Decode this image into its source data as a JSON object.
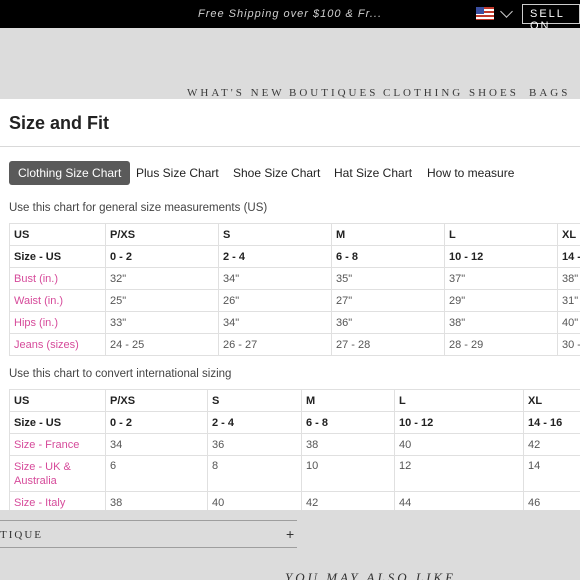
{
  "topbar": {
    "promo": "Free Shipping over $100 & Fr...",
    "flag_icon": "us-flag-icon",
    "chevron_icon": "chevron-down-icon",
    "sell_label": "SELL ON"
  },
  "nav": [
    "WHAT'S NEW",
    "BOUTIQUES",
    "CLOTHING",
    "SHOES",
    "BAGS"
  ],
  "page": {
    "accordion_label": "TIQUE",
    "accordion_icon": "plus-icon",
    "accordion_toggle": "+",
    "you_may_also_like": "YOU MAY ALSO LIKE"
  },
  "modal": {
    "title": "Size and Fit",
    "tabs": [
      {
        "label": "Clothing Size Chart",
        "active": true
      },
      {
        "label": "Plus Size Chart",
        "active": false
      },
      {
        "label": "Shoe Size Chart",
        "active": false
      },
      {
        "label": "Hat Size Chart",
        "active": false
      },
      {
        "label": "How to measure",
        "active": false
      }
    ],
    "general": {
      "caption": "Use this chart for general size measurements (US)",
      "columns": [
        "US",
        "P/XS",
        "S",
        "M",
        "L",
        "XL"
      ],
      "rows": [
        {
          "label": "Size - US",
          "values": [
            "0 - 2",
            "2 - 4",
            "6 - 8",
            "10 - 12",
            "14 -"
          ]
        },
        {
          "label": "Bust (in.)",
          "values": [
            "32\"",
            "34\"",
            "35\"",
            "37\"",
            "38\""
          ]
        },
        {
          "label": "Waist (in.)",
          "values": [
            "25\"",
            "26\"",
            "27\"",
            "29\"",
            "31\""
          ]
        },
        {
          "label": "Hips (in.)",
          "values": [
            "33\"",
            "34\"",
            "36\"",
            "38\"",
            "40\""
          ]
        },
        {
          "label": "Jeans (sizes)",
          "values": [
            "24 - 25",
            "26 - 27",
            "27 - 28",
            "28 - 29",
            "30 -"
          ]
        }
      ]
    },
    "international": {
      "caption": "Use this chart to convert international sizing",
      "columns": [
        "US",
        "P/XS",
        "S",
        "M",
        "L",
        "XL"
      ],
      "rows": [
        {
          "label": "Size - US",
          "values": [
            "0 - 2",
            "2 - 4",
            "6 - 8",
            "10 - 12",
            "14 - 16"
          ]
        },
        {
          "label": "Size - France",
          "values": [
            "34",
            "36",
            "38",
            "40",
            "42"
          ]
        },
        {
          "label": "Size - UK & Australia",
          "values": [
            "6",
            "8",
            "10",
            "12",
            "14"
          ]
        },
        {
          "label": "Size - Italy",
          "values": [
            "38",
            "40",
            "42",
            "44",
            "46"
          ]
        }
      ]
    }
  },
  "colors": {
    "accent_pink": "#d64a9a",
    "active_tab": "#5a5a5a",
    "overlay_bg": "#dcdcdc"
  }
}
